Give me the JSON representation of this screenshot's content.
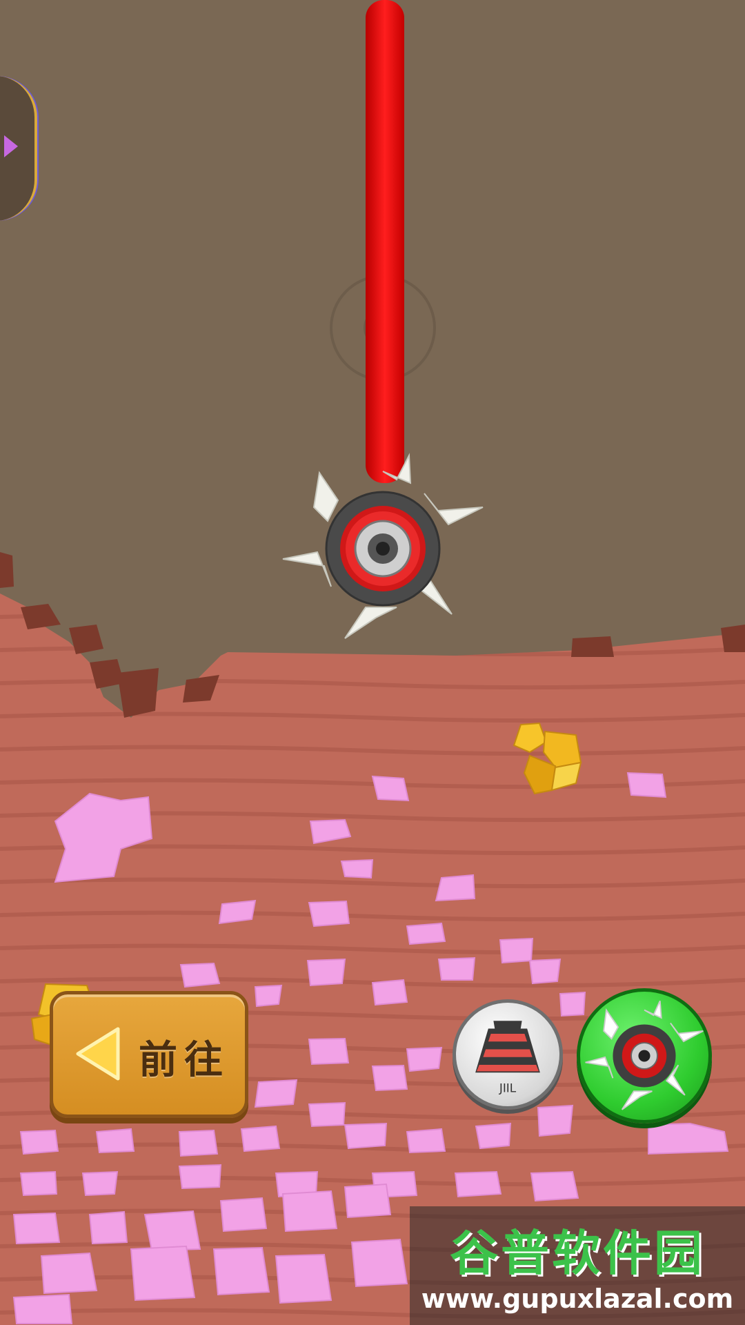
{
  "go_button": {
    "label": "前往"
  },
  "watermark": {
    "title": "谷普软件园",
    "url": "www.gupuxlazal.com"
  },
  "tools": {
    "grinder": {
      "caption": "JIIL"
    }
  },
  "colors": {
    "sky_dirt": "#7a6854",
    "soil": "#c06a5a",
    "crystal": "#f2a2e6",
    "rope": "#e81010",
    "gold": "#f2b820",
    "go_button": "#e1a033",
    "saw_button": "#2fcc2f"
  },
  "icons": [
    "chevron-right-icon",
    "back-arrow-icon",
    "grinder-tool-icon",
    "saw-blade-icon"
  ]
}
